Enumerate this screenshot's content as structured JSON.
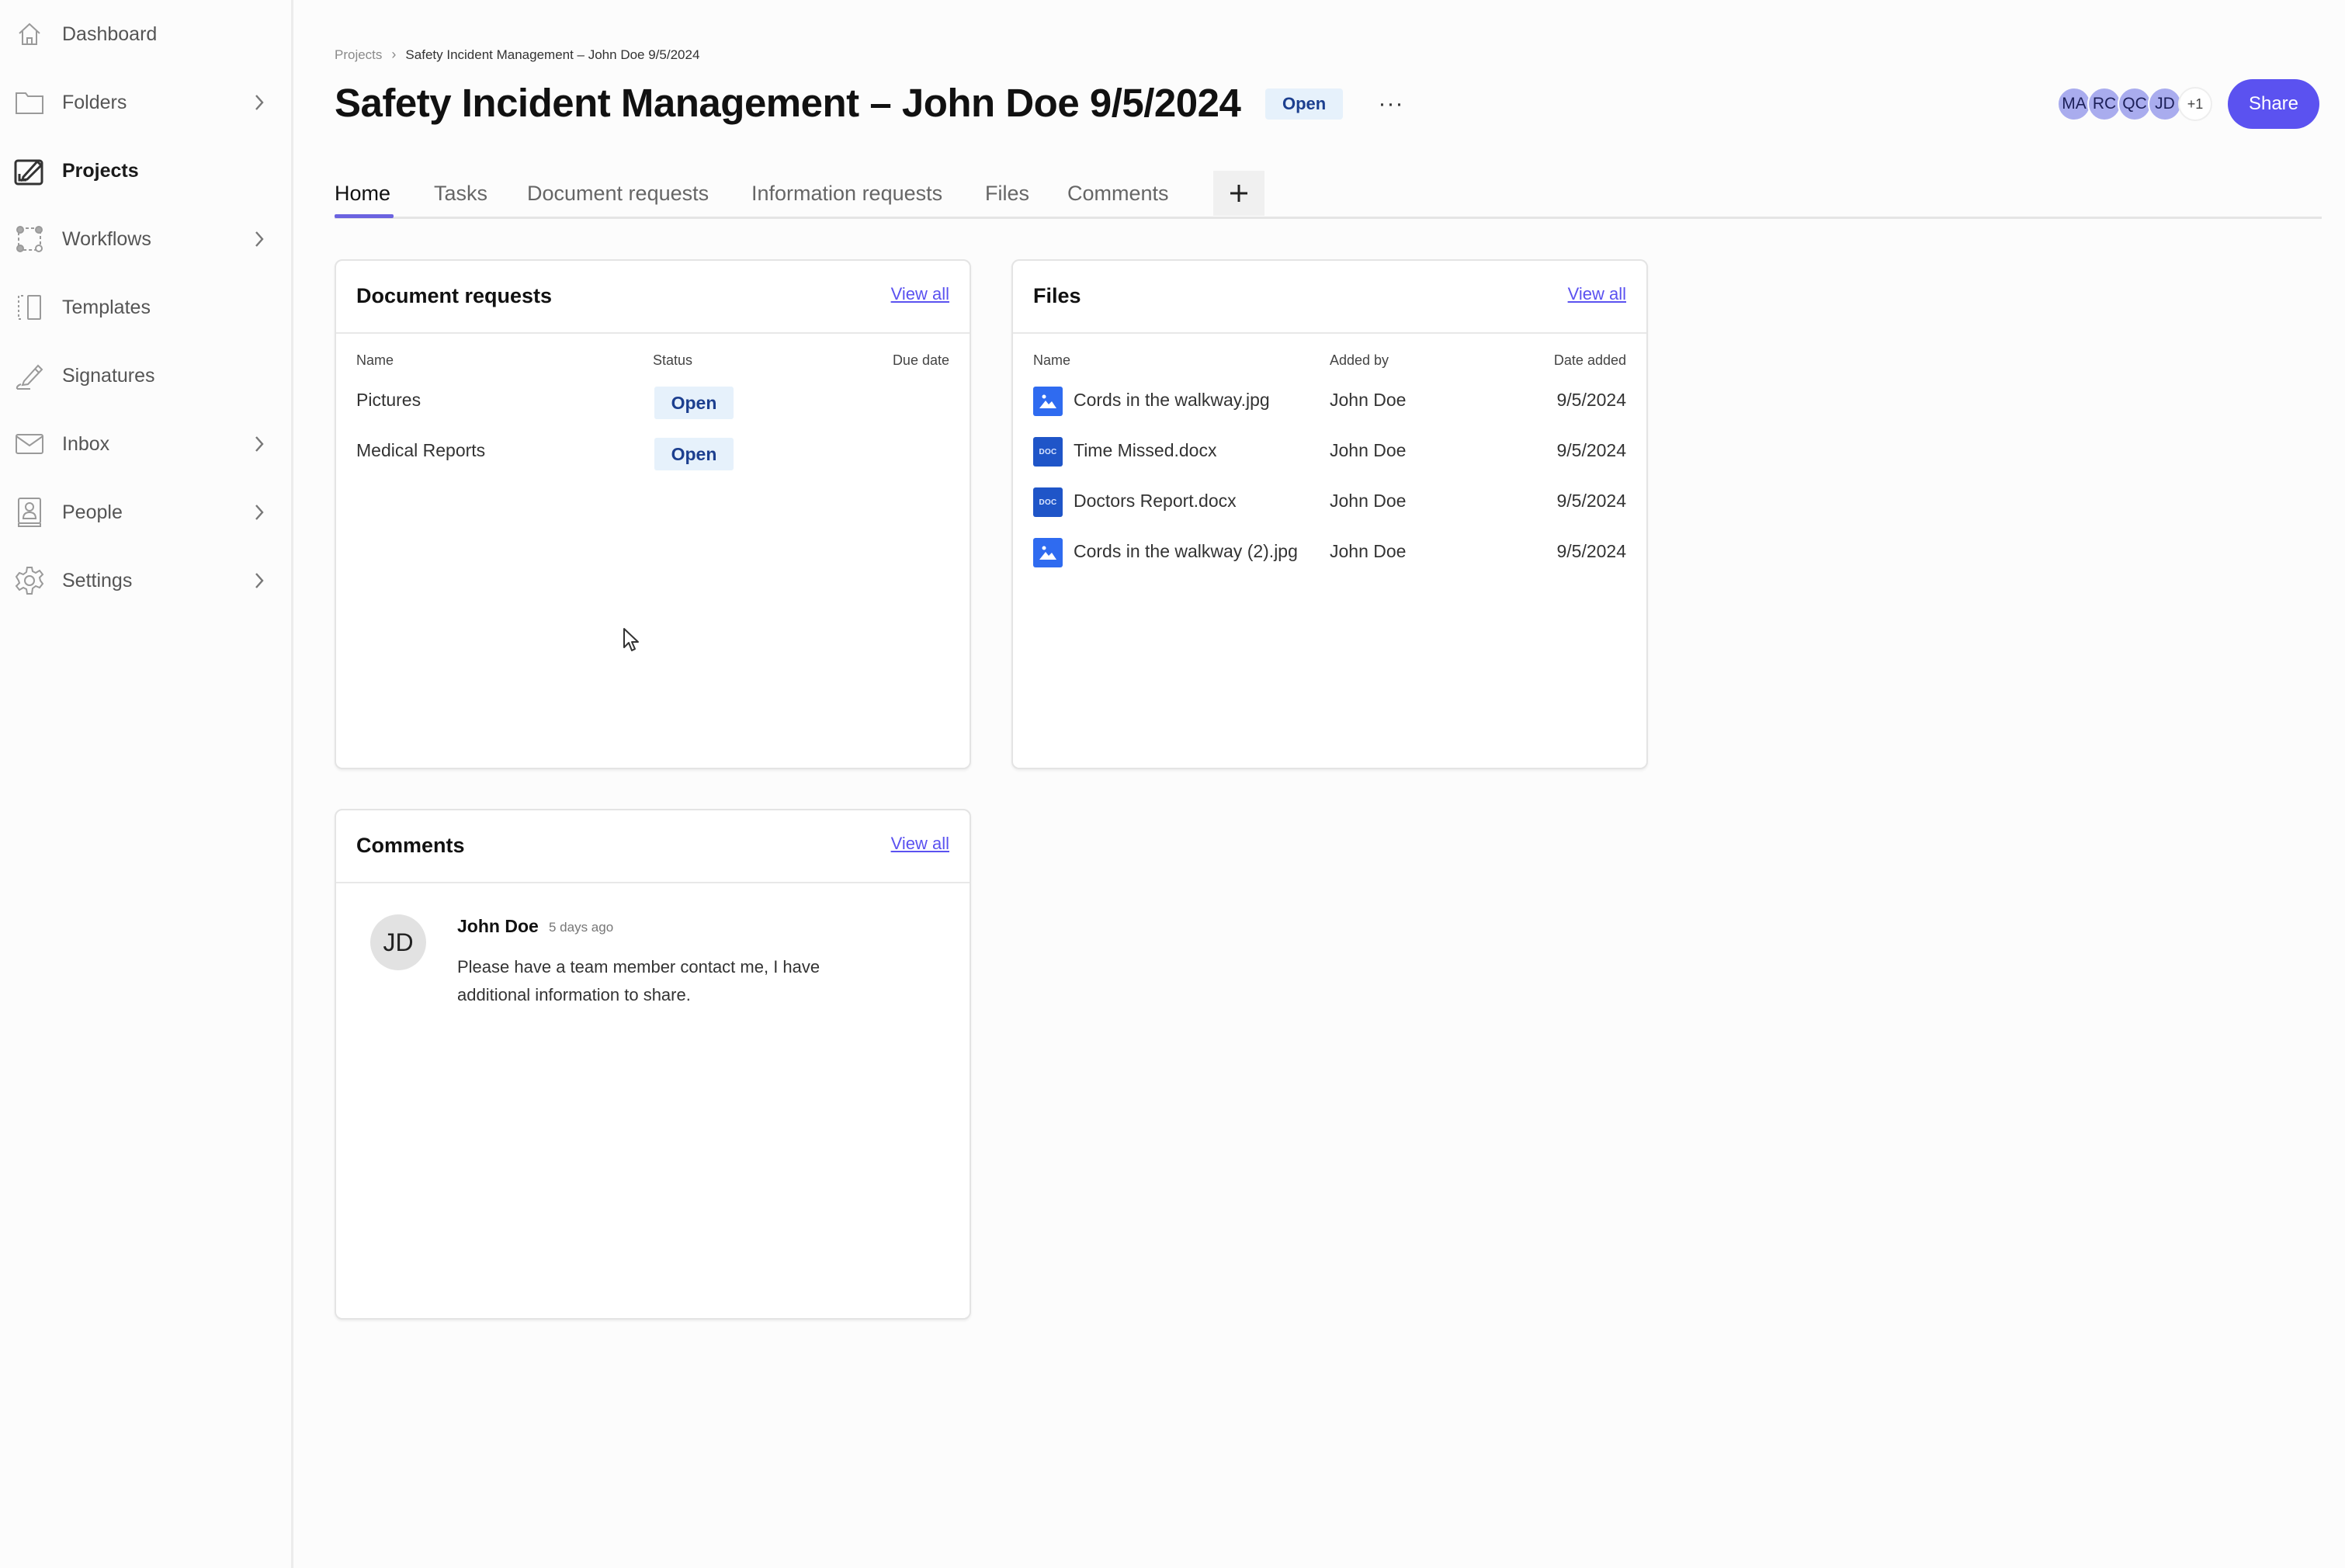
{
  "sidebar": {
    "items": [
      {
        "label": "Dashboard",
        "icon": "home-icon",
        "active": false,
        "has_chevron": false
      },
      {
        "label": "Folders",
        "icon": "folder-icon",
        "active": false,
        "has_chevron": true
      },
      {
        "label": "Projects",
        "icon": "projects-icon",
        "active": true,
        "has_chevron": false
      },
      {
        "label": "Workflows",
        "icon": "workflows-icon",
        "active": false,
        "has_chevron": true
      },
      {
        "label": "Templates",
        "icon": "templates-icon",
        "active": false,
        "has_chevron": false
      },
      {
        "label": "Signatures",
        "icon": "signature-pen-icon",
        "active": false,
        "has_chevron": false
      },
      {
        "label": "Inbox",
        "icon": "envelope-icon",
        "active": false,
        "has_chevron": true
      },
      {
        "label": "People",
        "icon": "contact-book-icon",
        "active": false,
        "has_chevron": true
      },
      {
        "label": "Settings",
        "icon": "gear-icon",
        "active": false,
        "has_chevron": true
      }
    ]
  },
  "header": {
    "breadcrumb": {
      "root": "Projects",
      "separator": "›",
      "current": "Safety Incident Management – John Doe 9/5/2024"
    },
    "title": "Safety Incident Management – John Doe 9/5/2024",
    "status_badge": "Open",
    "more_label": "···",
    "collaborators": [
      "MA",
      "RC",
      "QC",
      "JD"
    ],
    "collaborators_more": "+1",
    "share_label": "Share"
  },
  "tabs": {
    "items": [
      "Home",
      "Tasks",
      "Document requests",
      "Information requests",
      "Files",
      "Comments"
    ],
    "active": "Home",
    "add_label": "+"
  },
  "document_requests": {
    "title": "Document requests",
    "view_all": "View all",
    "columns": [
      "Name",
      "Status",
      "Due date"
    ],
    "rows": [
      {
        "name": "Pictures",
        "status": "Open",
        "due_date": ""
      },
      {
        "name": "Medical Reports",
        "status": "Open",
        "due_date": ""
      }
    ]
  },
  "files": {
    "title": "Files",
    "view_all": "View all",
    "columns": [
      "Name",
      "Added by",
      "Date added"
    ],
    "rows": [
      {
        "name": "Cords in the walkway.jpg",
        "type": "image",
        "icon_text": "",
        "added_by": "John Doe",
        "date_added": "9/5/2024"
      },
      {
        "name": "Time Missed.docx",
        "type": "doc",
        "icon_text": "DOC",
        "added_by": "John Doe",
        "date_added": "9/5/2024"
      },
      {
        "name": "Doctors Report.docx",
        "type": "doc",
        "icon_text": "DOC",
        "added_by": "John Doe",
        "date_added": "9/5/2024"
      },
      {
        "name": "Cords in the walkway (2).jpg",
        "type": "image",
        "icon_text": "",
        "added_by": "John Doe",
        "date_added": "9/5/2024"
      }
    ]
  },
  "comments": {
    "title": "Comments",
    "view_all": "View all",
    "items": [
      {
        "avatar": "JD",
        "author": "John Doe",
        "time": "5 days ago",
        "body": "Please have a team member contact me, I have additional information to share."
      }
    ]
  },
  "colors": {
    "accent": "#5b52f0",
    "tab_underline": "#6b63e0",
    "badge_bg": "#e6f1fb",
    "badge_text": "#1c3f8f",
    "image_icon": "#2f6bf0",
    "doc_icon": "#1f55c8",
    "avatar_bg": "#a9acee"
  }
}
